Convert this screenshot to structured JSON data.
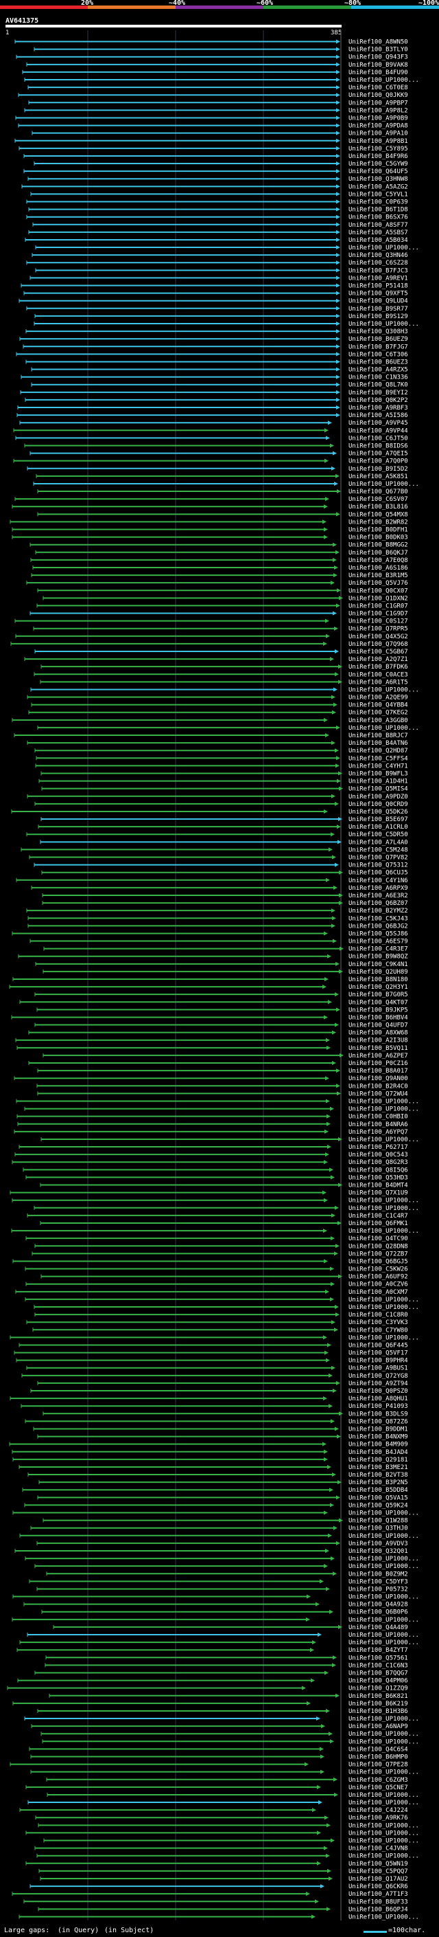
{
  "scale": {
    "ticks": [
      "20%",
      "~40%",
      "~60%",
      "~80%",
      "~100%"
    ],
    "colors": [
      "#e4232a",
      "#e7782b",
      "#8a2fa3",
      "#2a9b3b",
      "#1fb7e0"
    ]
  },
  "query": {
    "name": "AV641375",
    "start": "1",
    "end": "385"
  },
  "subject_colors": {
    "high": "#3ec4e6",
    "mid": "#38b34a",
    "low": "#1a7a30"
  },
  "rows": [
    "UniRef100_A8WN50",
    "UniRef100_B3TLY0",
    "UniRef100_Q943F3",
    "UniRef100_B9VAK8",
    "UniRef100_B4FU90",
    "UniRef100_UP1000...",
    "UniRef100_C6T0E8",
    "UniRef100_Q0JKK9",
    "UniRef100_A9PBP7",
    "UniRef100_A9P8L2",
    "UniRef100_A9P0B9",
    "UniRef100_A9PDA8",
    "UniRef100_A9PA10",
    "UniRef100_A9P8B1",
    "UniRef100_C5Y895",
    "UniRef100_B4F9R6",
    "UniRef100_C5GYW9",
    "UniRef100_Q64UF5",
    "UniRef100_Q3HNW8",
    "UniRef100_A5AZG2",
    "UniRef100_C5YVL1",
    "UniRef100_C0P639",
    "UniRef100_B6T1D8",
    "UniRef100_B6SX76",
    "UniRef100_A8SF77",
    "UniRef100_A5SBS7",
    "UniRef100_A5B034",
    "UniRef100_UP1000...",
    "UniRef100_Q3HN46",
    "UniRef100_C6SZ28",
    "UniRef100_B7FJC3",
    "UniRef100_A9REV1",
    "UniRef100_P51418",
    "UniRef100_Q9XFT5",
    "UniRef100_Q9LUD4",
    "UniRef100_B9SR77",
    "UniRef100_B9S129",
    "UniRef100_UP1000...",
    "UniRef100_Q308H3",
    "UniRef100_B6UEZ9",
    "UniRef100_B7FJG7",
    "UniRef100_C6T306",
    "UniRef100_B6UEZ3",
    "UniRef100_A4RZX5",
    "UniRef100_C1N336",
    "UniRef100_Q8L7K0",
    "UniRef100_B9EYI2",
    "UniRef100_Q0K2P2",
    "UniRef100_A9RBF3",
    "UniRef100_A5I586",
    "UniRef100_A9VP45",
    "UniRef100_A9VP44",
    "UniRef100_C6JT50",
    "UniRef100_B8IDS6",
    "UniRef100_A7QEI5",
    "UniRef100_A7Q0P0",
    "UniRef100_B9I5D2",
    "UniRef100_A5K851",
    "UniRef100_UP1000...",
    "UniRef100_Q677B0",
    "UniRef100_C6SV07",
    "UniRef100_B3L816",
    "UniRef100_Q54MX8",
    "UniRef100_B2WR82",
    "UniRef100_B0DFH1",
    "UniRef100_B0DK03",
    "UniRef100_B8MGG2",
    "UniRef100_B6QKJ7",
    "UniRef100_A7E0Q8",
    "UniRef100_A6S186",
    "UniRef100_B3R1M5",
    "UniRef100_Q5VJ76",
    "UniRef100_Q0CX07",
    "UniRef100_Q1DXN2",
    "UniRef100_C1GR07",
    "UniRef100_C1G9D7",
    "UniRef100_C0S127",
    "UniRef100_Q7RPR5",
    "UniRef100_Q4X5G2",
    "UniRef100_Q7Q968",
    "UniRef100_C5GB67",
    "UniRef100_A2Q7Z1",
    "UniRef100_B7FDK6",
    "UniRef100_C0ACE3",
    "UniRef100_A6R1T5",
    "UniRef100_UP1000...",
    "UniRef100_A2QE99",
    "UniRef100_Q4YBB4",
    "UniRef100_Q7KEG2",
    "UniRef100_A3GGB0",
    "UniRef100_UP1000...",
    "UniRef100_B8RJC7",
    "UniRef100_B4ATN6",
    "UniRef100_Q2HD87",
    "UniRef100_C5FFS4",
    "UniRef100_C4YH71",
    "UniRef100_B9WFL3",
    "UniRef100_A1D4H1",
    "UniRef100_Q5MIS4",
    "UniRef100_A9PDZ0",
    "UniRef100_Q0CRD9",
    "UniRef100_Q5DK26",
    "UniRef100_B5E697",
    "UniRef100_A1CRL0",
    "UniRef100_C5DR50",
    "UniRef100_A7L4A0",
    "UniRef100_C5M248",
    "UniRef100_Q7PV82",
    "UniRef100_Q75312",
    "UniRef100_Q6CUJ5",
    "UniRef100_C4Y1N6",
    "UniRef100_A6RPX9",
    "UniRef100_A6E3R2",
    "UniRef100_Q6BZ07",
    "UniRef100_B2YMZ2",
    "UniRef100_C5KJ43",
    "UniRef100_Q6BJG2",
    "UniRef100_Q5SJ86",
    "UniRef100_A6ES79",
    "UniRef100_C4R3E7",
    "UniRef100_B9W8QZ",
    "UniRef100_C9K4N1",
    "UniRef100_Q2UH89",
    "UniRef100_B8N180",
    "UniRef100_Q2H3Y1",
    "UniRef100_B7G0R5",
    "UniRef100_Q4KT07",
    "UniRef100_B9JKP5",
    "UniRef100_B6HBV4",
    "UniRef100_Q4UFD7",
    "UniRef100_A8XW68",
    "UniRef100_A2I3U8",
    "UniRef100_B5VQ11",
    "UniRef100_A6ZPE7",
    "UniRef100_P0CZ16",
    "UniRef100_B8A017",
    "UniRef100_Q9AN00",
    "UniRef100_B2R4C0",
    "UniRef100_Q72WU4",
    "UniRef100_UP1000...",
    "UniRef100_UP1000...",
    "UniRef100_C0HBI0",
    "UniRef100_B4NRA6",
    "UniRef100_A6YPQ7",
    "UniRef100_UP1000...",
    "UniRef100_P62717",
    "UniRef100_Q0C543",
    "UniRef100_Q8G2R3",
    "UniRef100_Q8I5Q6",
    "UniRef100_Q53HD3",
    "UniRef100_B4DMT4",
    "UniRef100_Q7X1U9",
    "UniRef100_UP1000...",
    "UniRef100_UP1000...",
    "UniRef100_C1C4R7",
    "UniRef100_Q6FMK1",
    "UniRef100_UP1000...",
    "UniRef100_Q4TC90",
    "UniRef100_Q28DN8",
    "UniRef100_Q72ZB7",
    "UniRef100_Q6BGJ5",
    "UniRef100_C5KW26",
    "UniRef100_A6UF92",
    "UniRef100_A0CZV6",
    "UniRef100_A0CXM7",
    "UniRef100_UP1000...",
    "UniRef100_UP1000...",
    "UniRef100_C1C8R0",
    "UniRef100_C3YVK3",
    "UniRef100_C7YW80",
    "UniRef100_UP1000...",
    "UniRef100_Q6F445",
    "UniRef100_Q5VF17",
    "UniRef100_B9PHR4",
    "UniRef100_A9BUS1",
    "UniRef100_Q72YG8",
    "UniRef100_A9ZT94",
    "UniRef100_Q0PSZ0",
    "UniRef100_A8QHU1",
    "UniRef100_P41093",
    "UniRef100_B3DLS9",
    "UniRef100_Q872Z6",
    "UniRef100_B9DDM1",
    "UniRef100_B4NXM9",
    "UniRef100_B4M909",
    "UniRef100_B4JAD4",
    "UniRef100_Q29181",
    "UniRef100_B3ME21",
    "UniRef100_B2VT38",
    "UniRef100_B3P2N5",
    "UniRef100_B5DDB4",
    "UniRef100_Q5VA15",
    "UniRef100_Q59K24",
    "UniRef100_UP1000...",
    "UniRef100_Q1W288",
    "UniRef100_Q3THJ0",
    "UniRef100_UP1000...",
    "UniRef100_A9VDV3",
    "UniRef100_Q32Q01",
    "UniRef100_UP1000...",
    "UniRef100_UP1000...",
    "UniRef100_B0Z9M2",
    "UniRef100_C5DYF3",
    "UniRef100_P05732",
    "UniRef100_UP1000...",
    "UniRef100_Q4A928",
    "UniRef100_Q6B0P6",
    "UniRef100_UP1000...",
    "UniRef100_Q4A489",
    "UniRef100_UP1000...",
    "UniRef100_UP1000...",
    "UniRef100_B4ZYT7",
    "UniRef100_Q57561",
    "UniRef100_C1C6N3",
    "UniRef100_B7QQG7",
    "UniRef100_Q4PM06",
    "UniRef100_Q1ZZQ9",
    "UniRef100_B6K821",
    "UniRef100_B6K219",
    "UniRef100_B1H3B6",
    "UniRef100_UP1000...",
    "UniRef100_A6NAP9",
    "UniRef100_UP1000...",
    "UniRef100_UP1000...",
    "UniRef100_Q4C6S4",
    "UniRef100_B6HMP0",
    "UniRef100_Q7PE28",
    "UniRef100_UP1000...",
    "UniRef100_C6ZGM3",
    "UniRef100_Q5CNE7",
    "UniRef100_UP1000...",
    "UniRef100_UP1000...",
    "UniRef100_C4J224",
    "UniRef100_A9RK76",
    "UniRef100_UP1000...",
    "UniRef100_UP1000...",
    "UniRef100_UP1000...",
    "UniRef100_C4JVN8",
    "UniRef100_UP1000...",
    "UniRef100_Q5WN19",
    "UniRef100_C5PQQ7",
    "UniRef100_Q17AU2",
    "UniRef100_Q6CKR6",
    "UniRef100_A7T1F3",
    "UniRef100_B8UF33",
    "UniRef100_B6QPJ4",
    "UniRef100_UP1000..."
  ],
  "footer": {
    "large_gaps_label": "Large gaps:",
    "in_query": "(in Query)",
    "in_subject": "(in Subject)",
    "legend_scale": "=100char."
  }
}
